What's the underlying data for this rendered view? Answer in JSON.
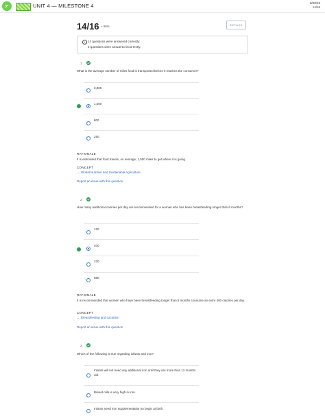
{
  "header": {
    "title": "UNIT 4 — MILESTONE 4",
    "meta_top": "9/20/18",
    "meta_bottom": "14/16"
  },
  "result": {
    "score": "14/16",
    "percent": "≈ 88%",
    "retake_label": "RETAKE",
    "summary_correct": "14 questions were answered correctly.",
    "summary_incorrect": "2 questions were answered incorrectly."
  },
  "questions": [
    {
      "number": "1",
      "text": "What is the average number of miles food is transported before it reaches the consumer?",
      "options": [
        "2,800",
        "1,500",
        "800",
        "250"
      ],
      "selected_index": 1,
      "rationale_label": "RATIONALE",
      "rationale": "It is estimated that food travels, on average, 1,500 miles to get where it is going.",
      "concept_label": "CONCEPT",
      "concept_link": "→ Global Nutrition and Sustainable Agriculture",
      "report_link": "Report an issue with this question"
    },
    {
      "number": "2",
      "text": "How many additional calories per day are recommended for a woman who has been breastfeeding longer than 6 months?",
      "options": [
        "120",
        "400",
        "220",
        "880"
      ],
      "selected_index": 1,
      "rationale_label": "RATIONALE",
      "rationale": "It is recommended that women who have been breastfeeding longer than 6 months consume an extra 400 calories per day.",
      "concept_label": "CONCEPT",
      "concept_link": "→ Breastfeeding and Lactation",
      "report_link": "Report an issue with this question"
    },
    {
      "number": "3",
      "text": "Which of the following is true regarding infants and iron?",
      "options": [
        "Infants will not need any additional iron until they are more than 12 months old.",
        "Breast milk is very high in iron.",
        "Infants need iron supplementation to begin at birth."
      ]
    }
  ],
  "colors": {
    "correct": "#2e9b5a",
    "link": "#2a66c7",
    "brand": "#6ad14a"
  }
}
